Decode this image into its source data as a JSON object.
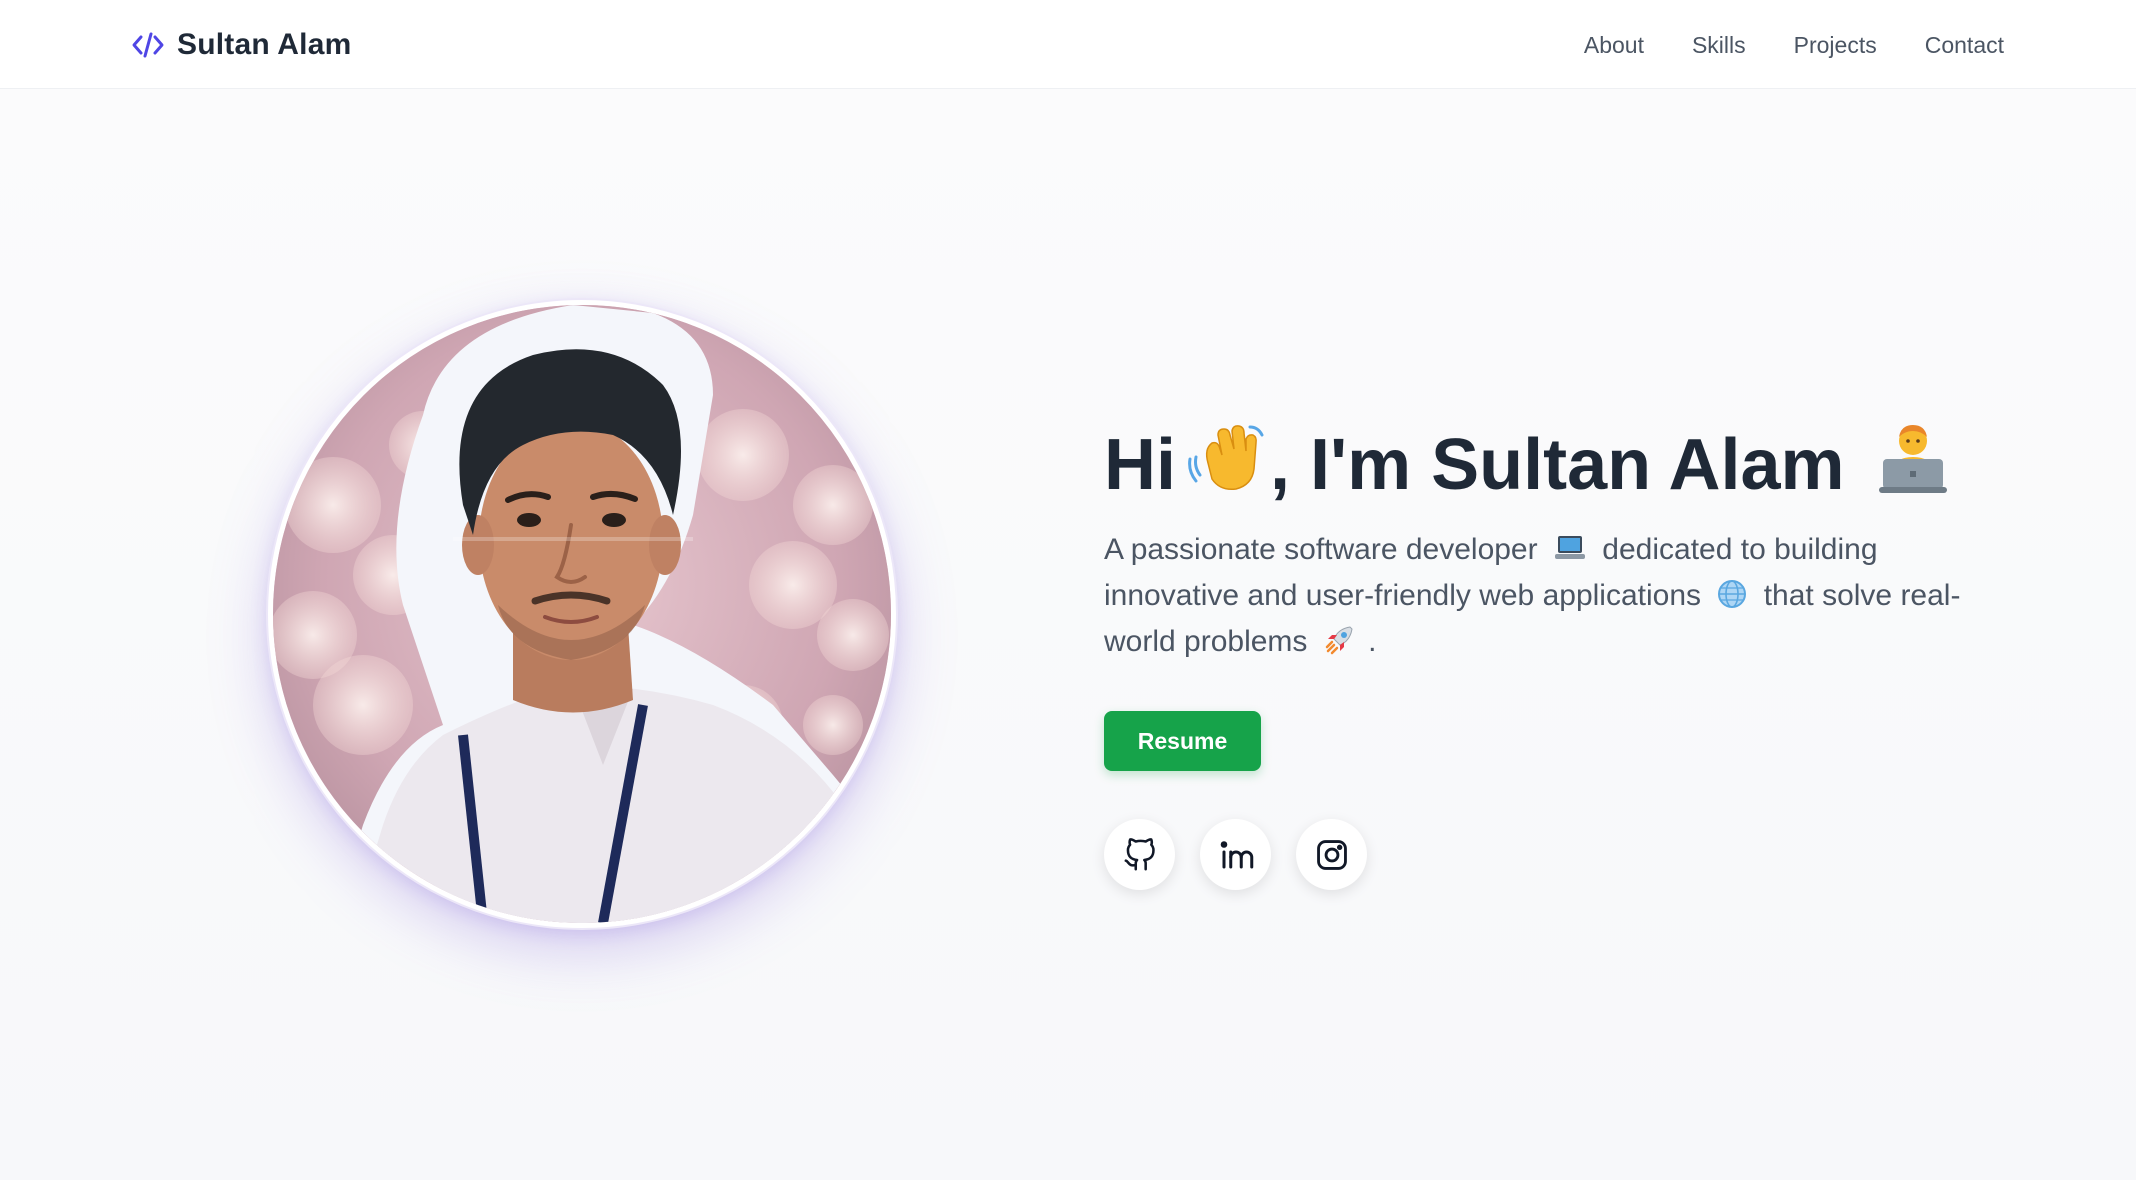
{
  "brand": {
    "icon": "code-icon",
    "name": "Sultan Alam",
    "accent_color": "#4f46e5"
  },
  "nav": {
    "items": [
      {
        "label": "About"
      },
      {
        "label": "Skills"
      },
      {
        "label": "Projects"
      },
      {
        "label": "Contact"
      }
    ]
  },
  "hero": {
    "headline": {
      "part1": "Hi",
      "part2": ", I'm Sultan Alam",
      "emoji1": "waving-hand-icon",
      "emoji2": "technologist-icon"
    },
    "tagline": {
      "part1": "A passionate software developer",
      "part2": "dedicated to building innovative and user-friendly web applications",
      "part3": "that solve real-world problems",
      "part4": ".",
      "emoji_laptop": "laptop-icon",
      "emoji_globe": "globe-icon",
      "emoji_rocket": "rocket-icon"
    },
    "resume_button": {
      "label": "Resume",
      "color": "#16a34a"
    },
    "socials": [
      {
        "icon": "github-icon"
      },
      {
        "icon": "linkedin-icon"
      },
      {
        "icon": "instagram-icon"
      }
    ],
    "avatar": {
      "icon": "profile-photo"
    }
  }
}
